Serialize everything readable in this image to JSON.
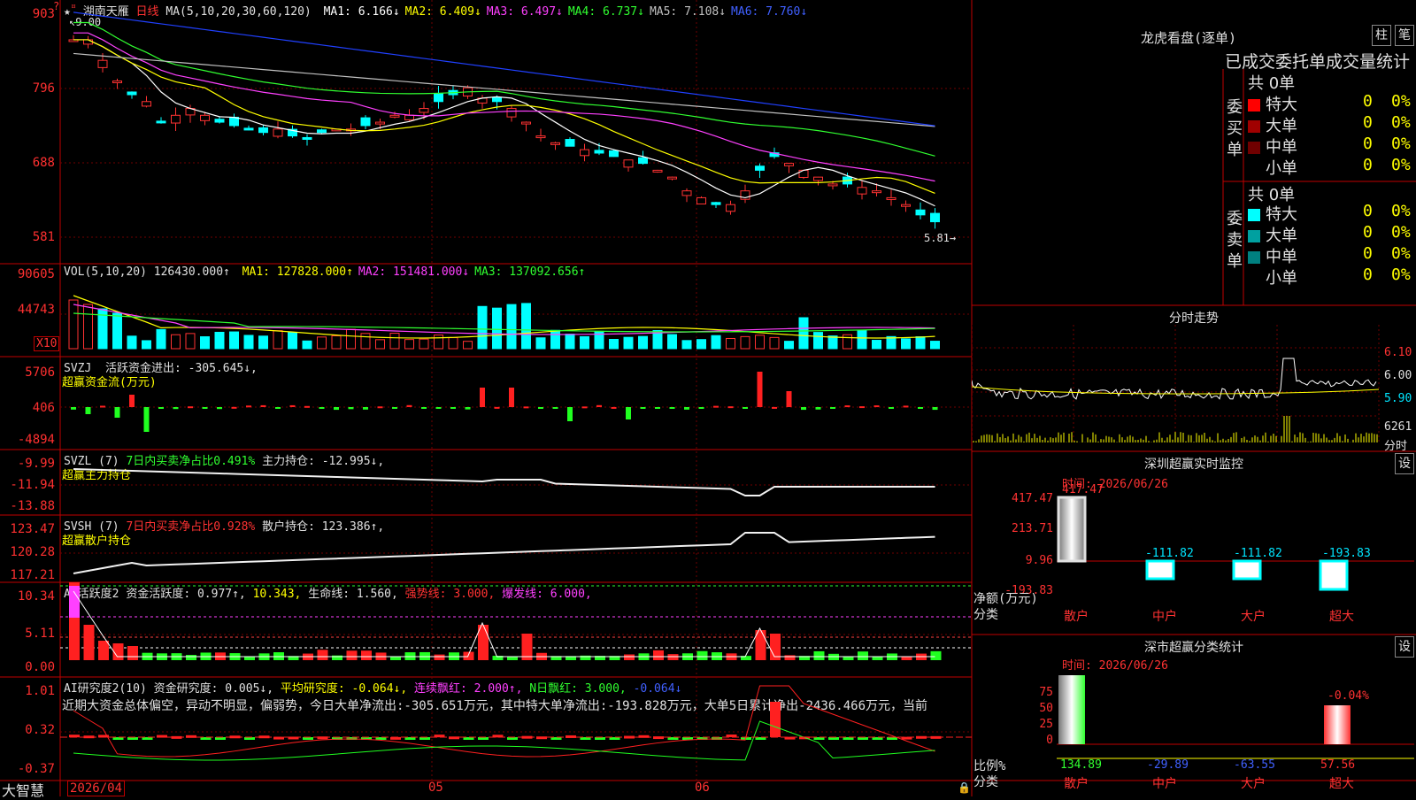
{
  "main": {
    "stock_name": "湖南天雁",
    "period": "日线",
    "ma_params": "MA(5,10,20,30,60,120)",
    "ma": [
      {
        "label": "MA1:",
        "value": "6.166↓",
        "color": "#ffffff"
      },
      {
        "label": "MA2:",
        "value": "6.409↓",
        "color": "#ffff00"
      },
      {
        "label": "MA3:",
        "value": "6.497↓",
        "color": "#ff40ff"
      },
      {
        "label": "MA4:",
        "value": "6.737↓",
        "color": "#30ff30"
      },
      {
        "label": "MA5:",
        "value": "7.108↓",
        "color": "#c0c0c0"
      },
      {
        "label": "MA6:",
        "value": "7.760↓",
        "color": "#4060ff"
      }
    ],
    "y_labels": [
      "903",
      "796",
      "688",
      "581"
    ],
    "high_marker": "9.00",
    "low_marker": "5.81"
  },
  "vol": {
    "label": "VOL(5,10,20)",
    "value": "126430.000↑",
    "ma": [
      {
        "label": "MA1:",
        "value": "127828.000↑",
        "color": "#ffff00"
      },
      {
        "label": "MA2:",
        "value": "151481.000↓",
        "color": "#ff40ff"
      },
      {
        "label": "MA3:",
        "value": "137092.656↑",
        "color": "#30ff30"
      }
    ],
    "y_labels": [
      "90605",
      "44743"
    ],
    "unit": "X10"
  },
  "svzj": {
    "label": "SVZJ",
    "desc": "活跃资金进出: -305.645↓,",
    "sub": "超赢资金流(万元)",
    "y_labels": [
      "5706",
      "406",
      "-4894"
    ]
  },
  "svzl": {
    "label": "SVZL (7)",
    "desc_green": "7日内买卖净占比0.491%",
    "desc_white": "主力持仓: -12.995↓,",
    "sub": "超赢主力持仓",
    "y_labels": [
      "-9.99",
      "-11.94",
      "-13.88"
    ]
  },
  "svsh": {
    "label": "SVSH (7)",
    "desc_red": "7日内买卖净占比0.928%",
    "desc_white": "散户持仓: 123.386↑,",
    "sub": "超赢散户持仓",
    "y_labels": [
      "123.47",
      "120.28",
      "117.21"
    ]
  },
  "ai1": {
    "label": "AI活跃度2",
    "desc": "资金活跃度: 0.977↑,",
    "v2": "10.343,",
    "life": "生命线: 1.560,",
    "strong": "强势线: 3.000,",
    "burst": "爆发线: 6.000,",
    "y_labels": [
      "10.34",
      "5.11",
      "0.00"
    ]
  },
  "ai2": {
    "label": "AI研究度2(10)",
    "desc": "资金研究度: 0.005↓,",
    "avg": "平均研究度: -0.064↓,",
    "red_line": "连续飘红: 2.000↑,",
    "n_red": "N日飘红: 3.000,",
    "last": "-0.064↓",
    "comment": "近期大资金总体偏空，异动不明显，偏弱势，今日大单净流出:-305.651万元，其中特大单净流出:-193.828万元，大单5日累计净出-2436.466万元，当前",
    "y_labels": [
      "1.01",
      "0.32",
      "-0.37"
    ]
  },
  "x_axis": {
    "labels": [
      "2026/04",
      "05",
      "06"
    ],
    "brand": "大智慧"
  },
  "dragon": {
    "title": "龙虎看盘(逐单)",
    "tab1": "柱",
    "tab2": "笔",
    "header": "已成交委托单成交量统计",
    "buy_label": "委买单",
    "sell_label": "委卖单",
    "buy_total": "共 0单",
    "sell_total": "共 0单",
    "buy_rows": [
      {
        "name": "特大",
        "color": "#ff0000",
        "v": "0",
        "p": "0%"
      },
      {
        "name": "大单",
        "color": "#a00000",
        "v": "0",
        "p": "0%"
      },
      {
        "name": "中单",
        "color": "#700000",
        "v": "0",
        "p": "0%"
      },
      {
        "name": "小单",
        "color": "",
        "v": "0",
        "p": "0%"
      }
    ],
    "sell_rows": [
      {
        "name": "特大",
        "color": "#00ffff",
        "v": "0",
        "p": "0%"
      },
      {
        "name": "大单",
        "color": "#00a0a0",
        "v": "0",
        "p": "0%"
      },
      {
        "name": "中单",
        "color": "#008080",
        "v": "0",
        "p": "0%"
      },
      {
        "name": "小单",
        "color": "",
        "v": "0",
        "p": "0%"
      }
    ]
  },
  "intraday": {
    "title": "分时走势",
    "y_labels": [
      "6.10",
      "6.00",
      "5.90"
    ],
    "vol_label": "6261",
    "fenshi": "分时"
  },
  "monitor": {
    "title": "深圳超赢实时监控",
    "setting": "设",
    "time": "时间: 2026/06/26",
    "y_labels": [
      "417.47",
      "213.71",
      "9.96",
      "-193.83"
    ],
    "top_val": "417.47",
    "net_label": "净额(万元)",
    "cat_label": "分类",
    "cats": [
      "散户",
      "中户",
      "大户",
      "超大"
    ],
    "vals": [
      "",
      "-111.82",
      "-111.82",
      "-193.83"
    ]
  },
  "classify": {
    "title": "深市超赢分类统计",
    "setting": "设",
    "time": "时间: 2026/06/26",
    "y_labels": [
      "75",
      "50",
      "25",
      "0"
    ],
    "ratio_label": "比例%",
    "cat_label": "分类",
    "top_note": "-0.04%",
    "cats": [
      "散户",
      "中户",
      "大户",
      "超大"
    ],
    "vals": [
      "134.89",
      "-29.89",
      "-63.55",
      "57.56"
    ]
  }
}
